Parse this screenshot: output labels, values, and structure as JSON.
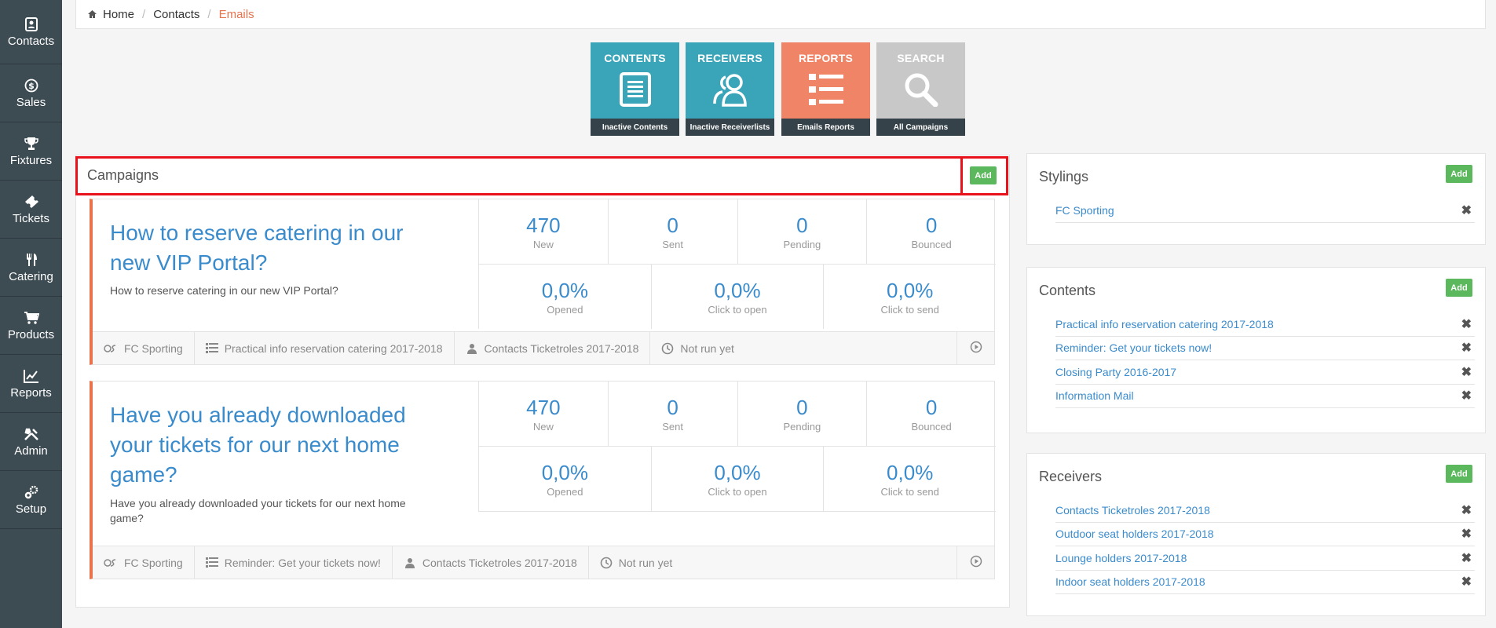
{
  "sidebar": {
    "items": [
      {
        "label": "Contacts",
        "icon": "contacts-icon"
      },
      {
        "label": "Sales",
        "icon": "dollar-icon"
      },
      {
        "label": "Fixtures",
        "icon": "trophy-icon"
      },
      {
        "label": "Tickets",
        "icon": "ticket-icon"
      },
      {
        "label": "Catering",
        "icon": "cutlery-icon"
      },
      {
        "label": "Products",
        "icon": "cart-icon"
      },
      {
        "label": "Reports",
        "icon": "chart-icon"
      },
      {
        "label": "Admin",
        "icon": "tools-icon"
      },
      {
        "label": "Setup",
        "icon": "gears-icon"
      }
    ]
  },
  "breadcrumb": {
    "home": "Home",
    "contacts": "Contacts",
    "current": "Emails"
  },
  "tiles": [
    {
      "title": "CONTENTS",
      "footer": "Inactive Contents",
      "color": "#3aa4b8",
      "icon": "document-icon"
    },
    {
      "title": "RECEIVERS",
      "footer": "Inactive Receiverlists",
      "color": "#3aa4b8",
      "icon": "users-icon"
    },
    {
      "title": "REPORTS",
      "footer": "Emails Reports",
      "color": "#ef8466",
      "icon": "list-icon"
    },
    {
      "title": "SEARCH",
      "footer": "All Campaigns",
      "color": "#c8c8c8",
      "icon": "search-icon"
    }
  ],
  "campaigns": {
    "title": "Campaigns",
    "add_label": "Add",
    "items": [
      {
        "title": "How to reserve catering in our new VIP Portal?",
        "description": "How to reserve catering in our new VIP Portal?",
        "stats_top": [
          {
            "value": "470",
            "label": "New"
          },
          {
            "value": "0",
            "label": "Sent"
          },
          {
            "value": "0",
            "label": "Pending"
          },
          {
            "value": "0",
            "label": "Bounced"
          }
        ],
        "stats_bottom": [
          {
            "value": "0,0%",
            "label": "Opened"
          },
          {
            "value": "0,0%",
            "label": "Click to open"
          },
          {
            "value": "0,0%",
            "label": "Click to send"
          }
        ],
        "footer": {
          "styling": "FC Sporting",
          "content": "Practical info reservation catering 2017-2018",
          "receivers": "Contacts Ticketroles 2017-2018",
          "status": "Not run yet"
        }
      },
      {
        "title": "Have you already downloaded your tickets for our next home game?",
        "description": "Have you already downloaded your tickets for our next home game?",
        "stats_top": [
          {
            "value": "470",
            "label": "New"
          },
          {
            "value": "0",
            "label": "Sent"
          },
          {
            "value": "0",
            "label": "Pending"
          },
          {
            "value": "0",
            "label": "Bounced"
          }
        ],
        "stats_bottom": [
          {
            "value": "0,0%",
            "label": "Opened"
          },
          {
            "value": "0,0%",
            "label": "Click to open"
          },
          {
            "value": "0,0%",
            "label": "Click to send"
          }
        ],
        "footer": {
          "styling": "FC Sporting",
          "content": "Reminder: Get your tickets now!",
          "receivers": "Contacts Ticketroles 2017-2018",
          "status": "Not run yet"
        }
      }
    ]
  },
  "stylings": {
    "title": "Stylings",
    "add_label": "Add",
    "items": [
      "FC Sporting"
    ]
  },
  "contents": {
    "title": "Contents",
    "add_label": "Add",
    "items": [
      "Practical info reservation catering 2017-2018",
      "Reminder: Get your tickets now!",
      "Closing Party 2016-2017",
      "Information Mail"
    ]
  },
  "receivers": {
    "title": "Receivers",
    "add_label": "Add",
    "items": [
      "Contacts Ticketroles 2017-2018",
      "Outdoor seat holders 2017-2018",
      "Lounge holders 2017-2018",
      "Indoor seat holders 2017-2018"
    ]
  },
  "remove_glyph": "✖",
  "colors": {
    "accent": "#3a8bcc",
    "orange": "#e8734d",
    "green": "#5cb85c",
    "sidebar": "#3d4b53",
    "highlight": "#e8131a"
  }
}
